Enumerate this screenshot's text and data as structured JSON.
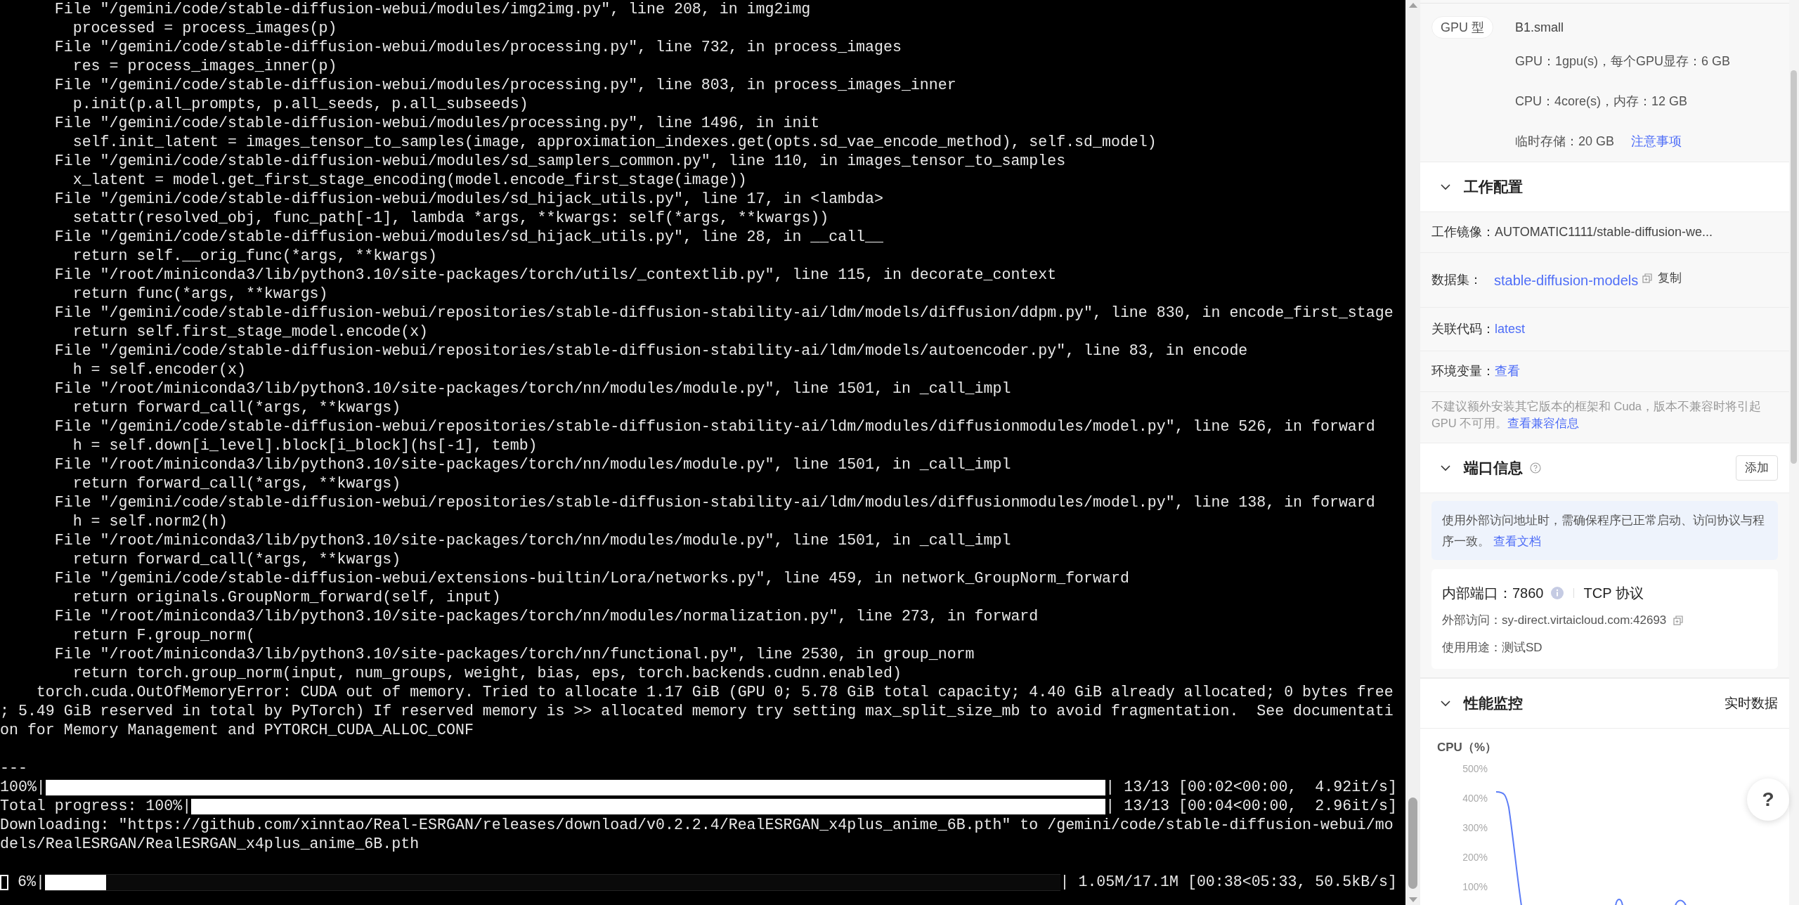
{
  "terminal": {
    "lines": [
      {
        "kind": "text",
        "text": "      File \"/gemini/code/stable-diffusion-webui/modules/img2img.py\", line 208, in img2img"
      },
      {
        "kind": "text",
        "text": "        processed = process_images(p)"
      },
      {
        "kind": "text",
        "text": "      File \"/gemini/code/stable-diffusion-webui/modules/processing.py\", line 732, in process_images"
      },
      {
        "kind": "text",
        "text": "        res = process_images_inner(p)"
      },
      {
        "kind": "text",
        "text": "      File \"/gemini/code/stable-diffusion-webui/modules/processing.py\", line 803, in process_images_inner"
      },
      {
        "kind": "text",
        "text": "        p.init(p.all_prompts, p.all_seeds, p.all_subseeds)"
      },
      {
        "kind": "text",
        "text": "      File \"/gemini/code/stable-diffusion-webui/modules/processing.py\", line 1496, in init"
      },
      {
        "kind": "text",
        "text": "        self.init_latent = images_tensor_to_samples(image, approximation_indexes.get(opts.sd_vae_encode_method), self.sd_model)"
      },
      {
        "kind": "text",
        "text": "      File \"/gemini/code/stable-diffusion-webui/modules/sd_samplers_common.py\", line 110, in images_tensor_to_samples"
      },
      {
        "kind": "text",
        "text": "        x_latent = model.get_first_stage_encoding(model.encode_first_stage(image))"
      },
      {
        "kind": "text",
        "text": "      File \"/gemini/code/stable-diffusion-webui/modules/sd_hijack_utils.py\", line 17, in <lambda>"
      },
      {
        "kind": "text",
        "text": "        setattr(resolved_obj, func_path[-1], lambda *args, **kwargs: self(*args, **kwargs))"
      },
      {
        "kind": "text",
        "text": "      File \"/gemini/code/stable-diffusion-webui/modules/sd_hijack_utils.py\", line 28, in __call__"
      },
      {
        "kind": "text",
        "text": "        return self.__orig_func(*args, **kwargs)"
      },
      {
        "kind": "text",
        "text": "      File \"/root/miniconda3/lib/python3.10/site-packages/torch/utils/_contextlib.py\", line 115, in decorate_context"
      },
      {
        "kind": "text",
        "text": "        return func(*args, **kwargs)"
      },
      {
        "kind": "text",
        "text": "      File \"/gemini/code/stable-diffusion-webui/repositories/stable-diffusion-stability-ai/ldm/models/diffusion/ddpm.py\", line 830, in encode_first_stage"
      },
      {
        "kind": "text",
        "text": "        return self.first_stage_model.encode(x)"
      },
      {
        "kind": "text",
        "text": "      File \"/gemini/code/stable-diffusion-webui/repositories/stable-diffusion-stability-ai/ldm/models/autoencoder.py\", line 83, in encode"
      },
      {
        "kind": "text",
        "text": "        h = self.encoder(x)"
      },
      {
        "kind": "text",
        "text": "      File \"/root/miniconda3/lib/python3.10/site-packages/torch/nn/modules/module.py\", line 1501, in _call_impl"
      },
      {
        "kind": "text",
        "text": "        return forward_call(*args, **kwargs)"
      },
      {
        "kind": "text",
        "text": "      File \"/gemini/code/stable-diffusion-webui/repositories/stable-diffusion-stability-ai/ldm/modules/diffusionmodules/model.py\", line 526, in forward"
      },
      {
        "kind": "text",
        "text": "        h = self.down[i_level].block[i_block](hs[-1], temb)"
      },
      {
        "kind": "text",
        "text": "      File \"/root/miniconda3/lib/python3.10/site-packages/torch/nn/modules/module.py\", line 1501, in _call_impl"
      },
      {
        "kind": "text",
        "text": "        return forward_call(*args, **kwargs)"
      },
      {
        "kind": "text",
        "text": "      File \"/gemini/code/stable-diffusion-webui/repositories/stable-diffusion-stability-ai/ldm/modules/diffusionmodules/model.py\", line 138, in forward"
      },
      {
        "kind": "text",
        "text": "        h = self.norm2(h)"
      },
      {
        "kind": "text",
        "text": "      File \"/root/miniconda3/lib/python3.10/site-packages/torch/nn/modules/module.py\", line 1501, in _call_impl"
      },
      {
        "kind": "text",
        "text": "        return forward_call(*args, **kwargs)"
      },
      {
        "kind": "text",
        "text": "      File \"/gemini/code/stable-diffusion-webui/extensions-builtin/Lora/networks.py\", line 459, in network_GroupNorm_forward"
      },
      {
        "kind": "text",
        "text": "        return originals.GroupNorm_forward(self, input)"
      },
      {
        "kind": "text",
        "text": "      File \"/root/miniconda3/lib/python3.10/site-packages/torch/nn/modules/normalization.py\", line 273, in forward"
      },
      {
        "kind": "text",
        "text": "        return F.group_norm("
      },
      {
        "kind": "text",
        "text": "      File \"/root/miniconda3/lib/python3.10/site-packages/torch/nn/functional.py\", line 2530, in group_norm"
      },
      {
        "kind": "text",
        "text": "        return torch.group_norm(input, num_groups, weight, bias, eps, torch.backends.cudnn.enabled)"
      },
      {
        "kind": "text",
        "text": "    torch.cuda.OutOfMemoryError: CUDA out of memory. Tried to allocate 1.17 GiB (GPU 0; 5.78 GiB total capacity; 4.40 GiB already allocated; 0 bytes free"
      },
      {
        "kind": "text",
        "text": "; 5.49 GiB reserved in total by PyTorch) If reserved memory is >> allocated memory try setting max_split_size_mb to avoid fragmentation.  See documentati"
      },
      {
        "kind": "text",
        "text": "on for Memory Management and PYTORCH_CUDA_ALLOC_CONF"
      },
      {
        "kind": "blank"
      },
      {
        "kind": "text",
        "text": "---"
      },
      {
        "kind": "progress",
        "cursor": false,
        "prefix": "100%|",
        "level": 1,
        "suffix": "| 13/13 [00:02<00:00,  4.92it/s]"
      },
      {
        "kind": "progress",
        "cursor": false,
        "prefix": "Total progress: 100%|",
        "level": 1,
        "suffix": "| 13/13 [00:04<00:00,  2.96it/s]"
      },
      {
        "kind": "text",
        "text": "Downloading: \"https://github.com/xinntao/Real-ESRGAN/releases/download/v0.2.2.4/RealESRGAN_x4plus_anime_6B.pth\" to /gemini/code/stable-diffusion-webui/mo"
      },
      {
        "kind": "text",
        "text": "dels/RealESRGAN/RealESRGAN_x4plus_anime_6B.pth"
      },
      {
        "kind": "blank"
      },
      {
        "kind": "progress",
        "cursor": true,
        "prefix": " 6%|",
        "level": 0.06,
        "suffix": "| 1.05M/17.1M [00:38<05:33, 50.5kB/s]"
      }
    ]
  },
  "instance": {
    "gpu_type_label": "GPU 型",
    "gpu_type": "B1.small",
    "specs": [
      {
        "text": "GPU：1gpu(s)，每个GPU显存：6 GB"
      },
      {
        "text": "CPU：4core(s)，内存：12 GB"
      },
      {
        "text": "临时存储：20 GB",
        "link": "注意事项"
      }
    ]
  },
  "work_config": {
    "title": "工作配置",
    "expanded": true,
    "rows": [
      {
        "kind": "text",
        "label": "工作镜像：",
        "value": "AUTOMATIC1111/stable-diffusion-we..."
      },
      {
        "kind": "link_copy",
        "label": "数据集：",
        "value": "stable-diffusion-models",
        "action": "复制"
      },
      {
        "kind": "link",
        "label": "关联代码：",
        "value": "latest"
      },
      {
        "kind": "link",
        "label": "环境变量：",
        "value": "查看"
      }
    ],
    "note": "不建议额外安装其它版本的框架和 Cuda，版本不兼容时将引起 GPU 不可用。",
    "note_link": "查看兼容信息"
  },
  "ports": {
    "title": "端口信息",
    "expanded": true,
    "add_button": "添加",
    "notice": "使用外部访问地址时，需确保程序已正常启动、访问协议与程序一致。",
    "notice_link": "查看文档",
    "port": {
      "internal": "内部端口：7860",
      "protocol": "TCP 协议",
      "external_label": "外部访问：",
      "external": "sy-direct.virtaicloud.com:42693",
      "usage": "使用用途：测试SD"
    }
  },
  "monitor": {
    "title": "性能监控",
    "expanded": true,
    "realtime": "实时数据",
    "chart_title": "CPU（%）",
    "yticks": [
      "500%",
      "400%",
      "300%",
      "200%",
      "100%"
    ]
  },
  "help_button": "?"
}
